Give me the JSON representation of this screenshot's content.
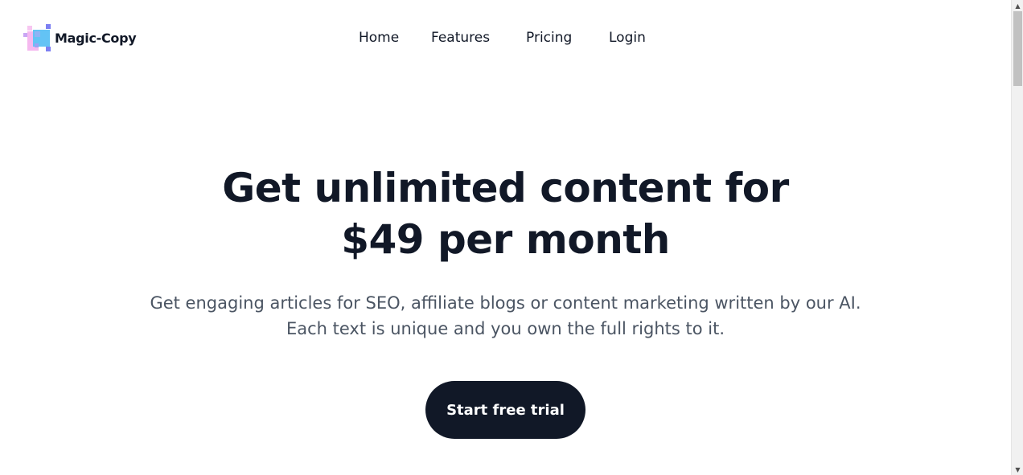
{
  "header": {
    "logo_text": "Magic-Copy",
    "logo_icon": "pixel-squares-logo-icon",
    "nav": [
      {
        "label": "Home"
      },
      {
        "label": "Features"
      },
      {
        "label": "Pricing"
      },
      {
        "label": "Login"
      }
    ]
  },
  "hero": {
    "title_line1": "Get unlimited content for",
    "title_line2": "$49 per month",
    "subtitle_line1": "Get engaging articles for SEO, affiliate blogs or content marketing written by our AI.",
    "subtitle_line2": "Each text is unique and you own the full rights to it.",
    "cta_label": "Start free trial"
  },
  "scrollbar": {
    "up_icon": "scroll-up-arrow-icon",
    "down_icon": "scroll-down-arrow-icon",
    "up_glyph": "▲",
    "down_glyph": "▼"
  },
  "colors": {
    "text_primary": "#111827",
    "text_secondary": "#4b5563",
    "cta_background": "#111827",
    "logo_pink": "#f5b8ef",
    "logo_blue": "#63c3f5",
    "logo_purple": "#7c7ff2"
  }
}
